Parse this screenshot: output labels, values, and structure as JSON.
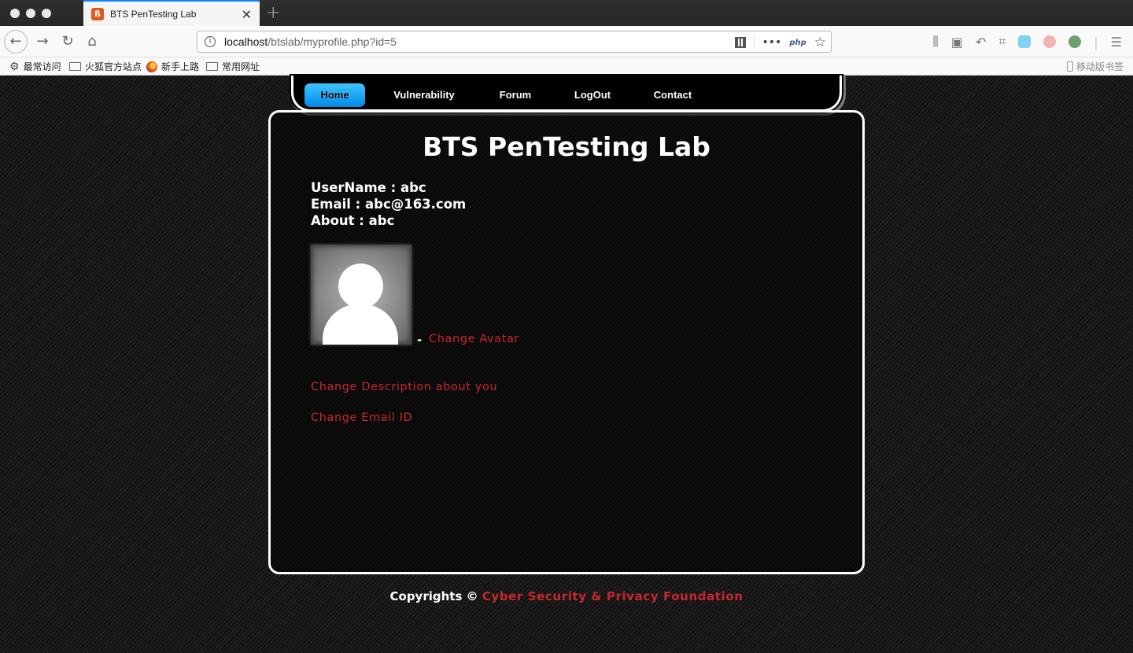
{
  "browser": {
    "tab_title": "BTS PenTesting Lab",
    "url_host": "localhost",
    "url_path": "/btslab/myprofile.php?id=5",
    "url_more": "•••",
    "url_php": "php",
    "bookmarks": [
      "最常访问",
      "火狐官方站点",
      "新手上路",
      "常用网址"
    ],
    "mobile_bookmarks": "移动版书签"
  },
  "menu": {
    "items": [
      "Home",
      "Vulnerability",
      "Forum",
      "LogOut",
      "Contact"
    ],
    "active": "Home"
  },
  "profile": {
    "site_title": "BTS PenTesting Lab",
    "username_line": "UserName : abc",
    "email_line": "Email : abc@163.com",
    "about_line": "About : abc",
    "dash": "-",
    "change_avatar": "Change Avatar",
    "change_description": "Change Description about you",
    "change_email": "Change Email ID"
  },
  "footer": {
    "label": "Copyrights © ",
    "org": "Cyber Security & Privacy Foundation"
  },
  "colors": {
    "accent_link": "#c8262e",
    "menu_active": "#1aa7f5",
    "background": "#141414"
  }
}
